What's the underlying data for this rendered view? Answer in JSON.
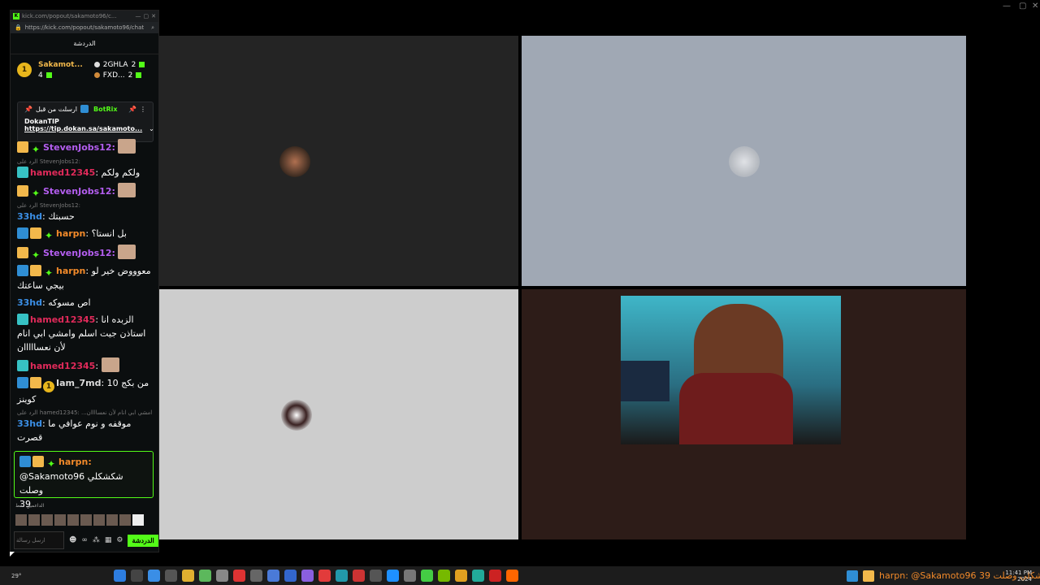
{
  "popout": {
    "title": "kick.com/popout/sakamoto96/c...",
    "url": "https://kick.com/popout/sakamoto96/chat",
    "chat_title": "الدردشة"
  },
  "leaderboard": {
    "first": {
      "rank": "1",
      "name": "Sakamot...",
      "count": "4"
    },
    "second": {
      "name": "2GHLA",
      "count": "2"
    },
    "third": {
      "name": "FXD...",
      "count": "2"
    }
  },
  "pinned": {
    "label": "ارسلت من قبل",
    "bot": "BotRix",
    "title": "DokanTIP",
    "link": "https://tip.dokan.sa/sakamoto..."
  },
  "messages": [
    {
      "user": "StevenJobs12:",
      "text": "",
      "color": "purple"
    },
    {
      "reply": "الرد على StevenJobs12:",
      "user": "hamed12345",
      "text": ": ولكم ولكم",
      "color": "red"
    },
    {
      "user": "StevenJobs12:",
      "text": "",
      "color": "purple"
    },
    {
      "reply": "الرد على StevenJobs12:",
      "user": "33hd",
      "text": ": حسبتك",
      "color": "blue"
    },
    {
      "user": "harpn",
      "text": ": بل انستا؟",
      "color": "orange"
    },
    {
      "user": "StevenJobs12:",
      "text": "",
      "color": "purple"
    },
    {
      "user": "harpn",
      "text": ": معوووض خير لو بيجي ساعتك",
      "color": "orange"
    },
    {
      "user": "33hd",
      "text": ": اص مسوكه",
      "color": "blue"
    },
    {
      "user": "hamed12345",
      "text": ": الزبده انا استاذن جيت اسلم وامشي ابي انام لأن نعسااااان",
      "color": "red"
    },
    {
      "user": "hamed12345",
      "text": ":",
      "color": "red"
    },
    {
      "user": "Iam_7md",
      "text": ": من بكج 10 كوينز",
      "color": "blue"
    },
    {
      "reply": "الرد على hamed12345: ...امشي ابي انام لأن نعساااان",
      "user": "33hd",
      "text": ": موقفه و نوم عوافي ما قصرت",
      "color": "blue"
    }
  ],
  "highlight": {
    "user": "harpn:",
    "line1": "@Sakamoto96 شكشكلي وصلت",
    "line2": "39"
  },
  "supporters_label": "الداعمين فقط",
  "input": {
    "placeholder": "ارسل رسالة",
    "send": "الدردشة"
  },
  "taskbar": {
    "weather": "29°",
    "tray_text": "harpn: @Sakamoto96 شكشكلي وصلت 39",
    "time": "11:41 PM",
    "date": "2024"
  },
  "colors": {
    "kick_green": "#53fc18",
    "purple": "#b45ef0",
    "red": "#e02a5a",
    "blue": "#3b8fe6",
    "orange": "#f28a2a"
  }
}
